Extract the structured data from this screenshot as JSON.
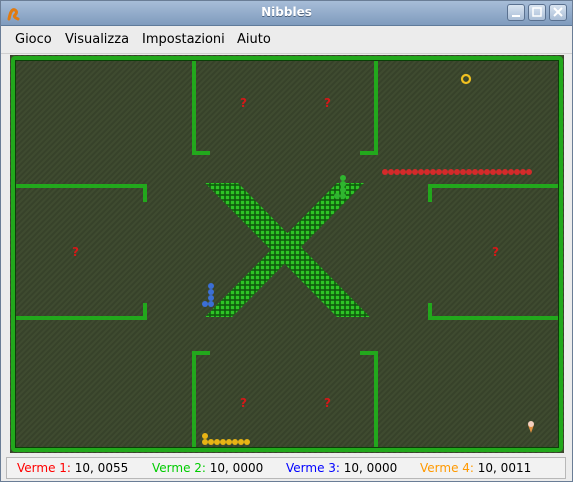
{
  "window": {
    "title": "Nibbles"
  },
  "menu": {
    "items": [
      "Gioco",
      "Visualizza",
      "Impostazioni",
      "Aiuto"
    ]
  },
  "game": {
    "background_color": "#3d4a2e",
    "wall_color": "#22a81c",
    "bonus_items": [
      "question-mark",
      "question-mark",
      "question-mark",
      "question-mark",
      "question-mark",
      "question-mark",
      "ring",
      "ice-cream"
    ],
    "worm_colors": [
      "#d42a2a",
      "#2fb52f",
      "#3b6fd6",
      "#e8b414"
    ]
  },
  "status": {
    "worms": [
      {
        "label": "Verme 1:",
        "score": "10, 0055",
        "color": "#ff0000"
      },
      {
        "label": "Verme 2:",
        "score": "10, 0000",
        "color": "#00cc00"
      },
      {
        "label": "Verme 3:",
        "score": "10, 0000",
        "color": "#0000ff"
      },
      {
        "label": "Verme 4:",
        "score": "10, 0011",
        "color": "#ff9900"
      }
    ]
  }
}
